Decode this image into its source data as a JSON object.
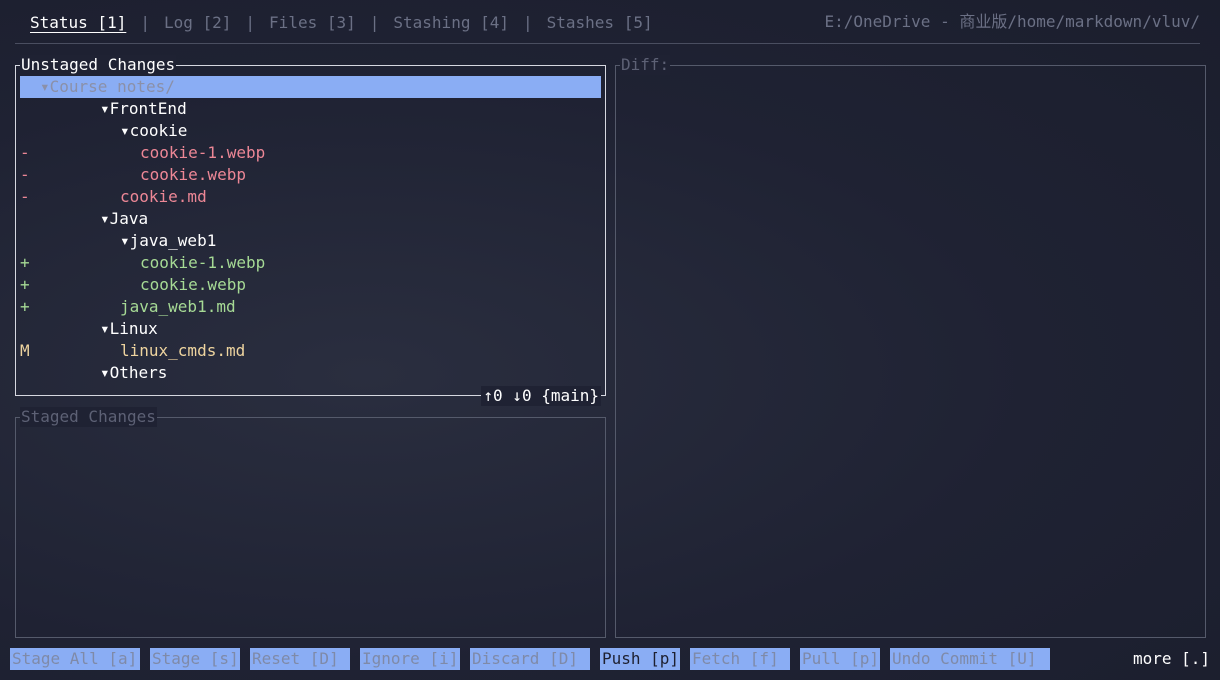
{
  "tabs": [
    {
      "label": "Status [1]"
    },
    {
      "label": "Log [2]"
    },
    {
      "label": "Files [3]"
    },
    {
      "label": "Stashing [4]"
    },
    {
      "label": "Stashes [5]"
    }
  ],
  "separator": "|",
  "repo_path": "E:/OneDrive - 商业版/home/markdown/vluv/",
  "unstaged": {
    "title": "Unstaged Changes",
    "footer": "↑0 ↓0 {main}",
    "rows": [
      {
        "status": "",
        "label": "▾Course notes/",
        "kind": "dir",
        "selected": true
      },
      {
        "status": "",
        "label": "▾FrontEnd",
        "kind": "dir"
      },
      {
        "status": "",
        "label": "▾cookie",
        "kind": "dir"
      },
      {
        "status": "-",
        "label": "cookie-1.webp",
        "kind": "del"
      },
      {
        "status": "-",
        "label": "cookie.webp",
        "kind": "del"
      },
      {
        "status": "-",
        "label": "cookie.md",
        "kind": "del"
      },
      {
        "status": "",
        "label": "▾Java",
        "kind": "dir"
      },
      {
        "status": "",
        "label": "▾java_web1",
        "kind": "dir"
      },
      {
        "status": "+",
        "label": "cookie-1.webp",
        "kind": "add"
      },
      {
        "status": "+",
        "label": "cookie.webp",
        "kind": "add"
      },
      {
        "status": "+",
        "label": "java_web1.md",
        "kind": "add"
      },
      {
        "status": "",
        "label": "▾Linux",
        "kind": "dir"
      },
      {
        "status": "M",
        "label": "linux_cmds.md",
        "kind": "mod"
      },
      {
        "status": "",
        "label": "▾Others",
        "kind": "dir"
      }
    ]
  },
  "staged": {
    "title": "Staged Changes"
  },
  "diff": {
    "title": "Diff:"
  },
  "keybar": [
    {
      "label": "Stage All [a]"
    },
    {
      "label": "Stage [s]"
    },
    {
      "label": "Reset [D]"
    },
    {
      "label": "Ignore [i]"
    },
    {
      "label": "Discard [D]"
    },
    {
      "label": "Push [p]",
      "primary": true
    },
    {
      "label": "Fetch [f]"
    },
    {
      "label": "Pull [p]"
    },
    {
      "label": "Undo Commit [U]"
    }
  ],
  "more": "more [.]",
  "colors": {
    "accent": "#8aadf4",
    "deleted": "#ed8796",
    "added": "#a6da95",
    "modified": "#eed49f",
    "background": "#1f2233"
  }
}
